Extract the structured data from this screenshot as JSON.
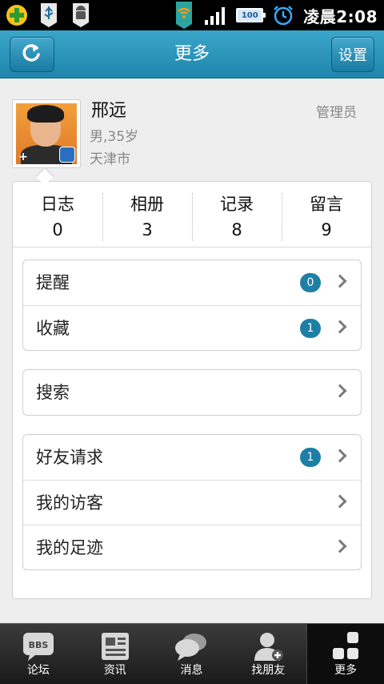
{
  "status_bar": {
    "time": "凌晨2:08",
    "battery": "100",
    "icons": [
      "app-plus-icon",
      "usb-icon",
      "android-debug-icon",
      "wifi-icon",
      "signal-icon",
      "battery-icon",
      "alarm-icon"
    ]
  },
  "header": {
    "title": "更多",
    "refresh_icon": "refresh-icon",
    "settings_label": "设置"
  },
  "profile": {
    "name": "邢远",
    "gender_age": "男,35岁",
    "city": "天津市",
    "role": "管理员"
  },
  "stats": [
    {
      "label": "日志",
      "value": "0"
    },
    {
      "label": "相册",
      "value": "3"
    },
    {
      "label": "记录",
      "value": "8"
    },
    {
      "label": "留言",
      "value": "9"
    }
  ],
  "groups": {
    "group1": [
      {
        "label": "提醒",
        "badge": "0"
      },
      {
        "label": "收藏",
        "badge": "1"
      }
    ],
    "group2": [
      {
        "label": "搜索"
      }
    ],
    "group3": [
      {
        "label": "好友请求",
        "badge": "1"
      },
      {
        "label": "我的访客"
      },
      {
        "label": "我的足迹"
      }
    ]
  },
  "tabs": [
    {
      "label": "论坛",
      "icon": "bbs-icon"
    },
    {
      "label": "资讯",
      "icon": "news-icon"
    },
    {
      "label": "消息",
      "icon": "chat-icon"
    },
    {
      "label": "找朋友",
      "icon": "add-friend-icon"
    },
    {
      "label": "更多",
      "icon": "more-grid-icon",
      "active": true
    }
  ],
  "colors": {
    "header": "#2b96bd",
    "badge": "#1e7fa6",
    "tabbar": "#2a2a2a"
  }
}
